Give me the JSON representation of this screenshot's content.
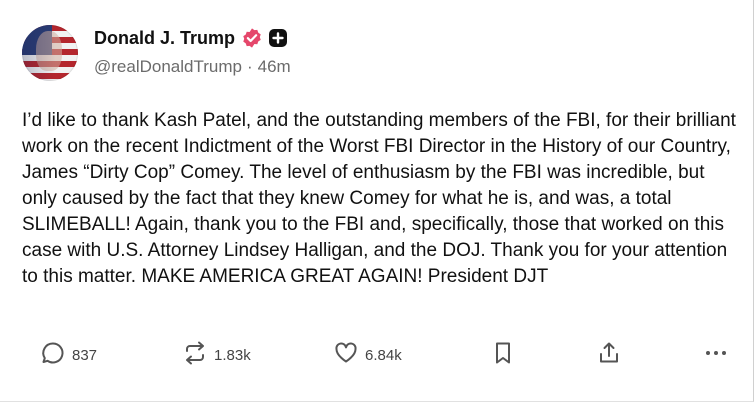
{
  "author": {
    "display_name": "Donald J. Trump",
    "handle": "@realDonaldTrump",
    "separator": "·",
    "time_ago": "46m",
    "verified_color": "#e5476b"
  },
  "post": {
    "text": "I’d like to thank Kash Patel, and the outstanding members of the FBI, for their brilliant work on the recent Indictment of the Worst FBI Director in the History of our Country, James “Dirty Cop” Comey. The level of enthusiasm by the FBI was incredible, but only caused by the fact that they knew Comey for what he is, and was, a total SLIMEBALL! Again, thank you to the FBI and, specifically, those that worked on this case with U.S. Attorney Lindsey Halligan, and the DOJ. Thank you for your attention to this matter. MAKE AMERICA GREAT AGAIN! President DJT"
  },
  "actions": {
    "reply": {
      "icon": "reply-icon",
      "count": "837"
    },
    "retruth": {
      "icon": "repost-icon",
      "count": "1.83k"
    },
    "like": {
      "icon": "heart-icon",
      "count": "6.84k"
    },
    "bookmark": {
      "icon": "bookmark-icon"
    },
    "share": {
      "icon": "share-icon"
    },
    "more": {
      "icon": "more-options-icon"
    }
  }
}
